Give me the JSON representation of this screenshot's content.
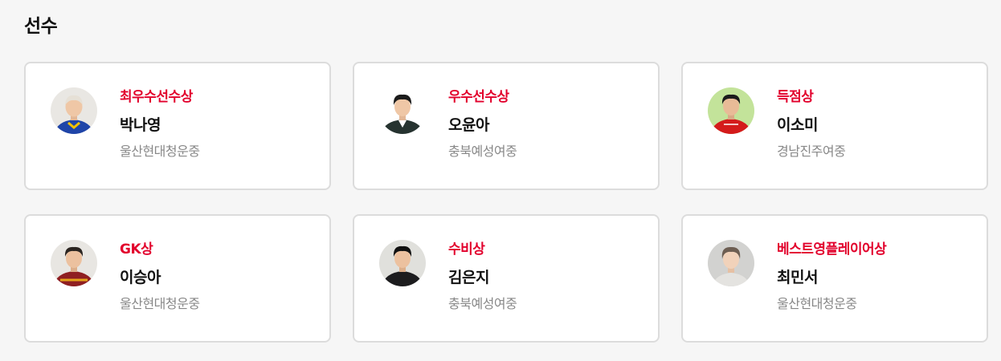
{
  "section": {
    "title": "선수"
  },
  "colors": {
    "accent": "#e2002c",
    "name": "#111111",
    "school": "#888888",
    "border": "#dcdcdc"
  },
  "players": [
    {
      "award": "최우수선수상",
      "name": "박나영",
      "school": "울산현대청운중",
      "photo": "player-photo-blue-yellow-jersey"
    },
    {
      "award": "우수선수상",
      "name": "오윤아",
      "school": "충북예성여중",
      "photo": "player-photo-dark-blazer"
    },
    {
      "award": "득점상",
      "name": "이소미",
      "school": "경남진주여중",
      "photo": "player-photo-red-jersey"
    },
    {
      "award": "GK상",
      "name": "이승아",
      "school": "울산현대청운중",
      "photo": "player-photo-maroon-goalkeeper-jersey"
    },
    {
      "award": "수비상",
      "name": "김은지",
      "school": "충북예성여중",
      "photo": "player-photo-dark-shirt"
    },
    {
      "award": "베스트영플레이어상",
      "name": "최민서",
      "school": "울산현대청운중",
      "photo": "player-photo-light-background"
    }
  ]
}
